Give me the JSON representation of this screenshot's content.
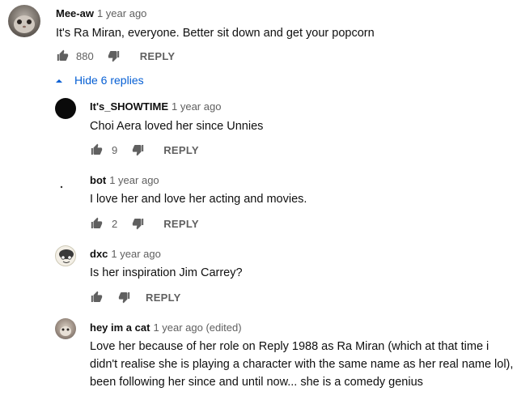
{
  "comment": {
    "author": "Mee-aw",
    "time": "1 year ago",
    "text": "It's Ra Miran, everyone. Better sit down and get your popcorn",
    "likes": "880",
    "reply_label": "REPLY"
  },
  "toggle": {
    "label": "Hide 6 replies",
    "icon": "caret-up-icon"
  },
  "replies": [
    {
      "author": "It's_SHOWTIME",
      "time": "1 year ago",
      "text": "Choi Aera loved her since Unnies",
      "likes": "9",
      "reply_label": "REPLY"
    },
    {
      "author": "bot",
      "time": "1 year ago",
      "text": "I love her and love her acting and movies.",
      "likes": "2",
      "reply_label": "REPLY"
    },
    {
      "author": "dxc",
      "time": "1 year ago",
      "text": "Is her inspiration Jim Carrey?",
      "likes": "",
      "reply_label": "REPLY"
    },
    {
      "author": "hey im a cat",
      "time": "1 year ago (edited)",
      "text_lines": [
        "Love her because of her role on Reply 1988 as Ra Miran (which at that time i",
        "didn't realise she is playing a character with the same name as her real name lol),",
        "been following her since and until now... she is a comedy genius"
      ]
    }
  ],
  "colors": {
    "link": "#065fd4",
    "secondary": "#606060",
    "primary": "#0f0f0f"
  }
}
